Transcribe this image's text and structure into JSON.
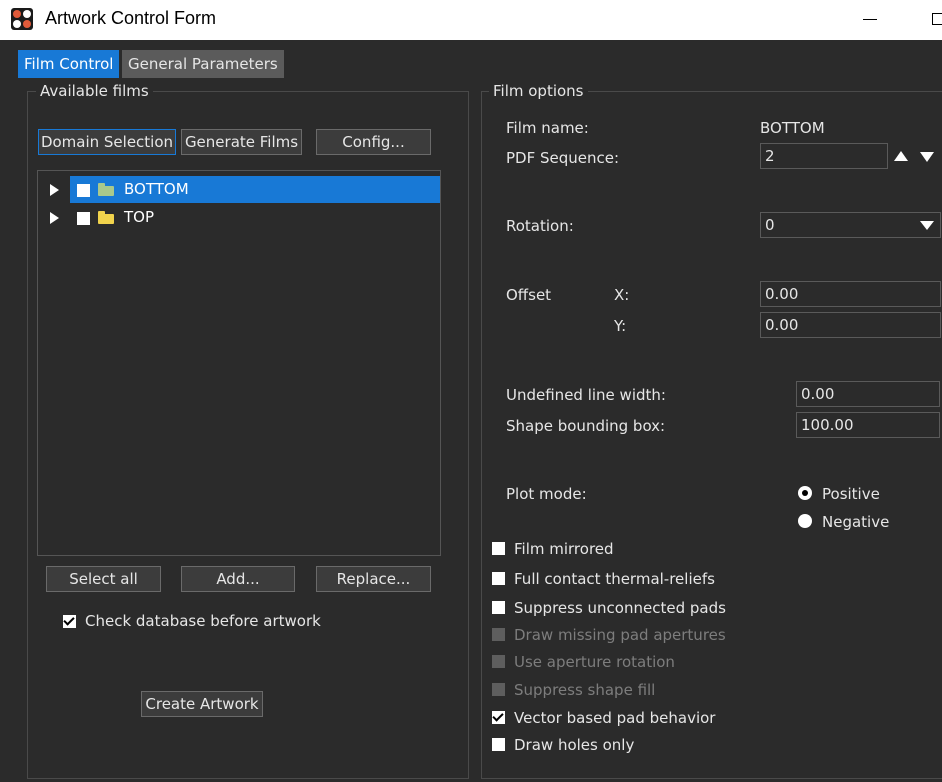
{
  "window": {
    "title": "Artwork Control Form"
  },
  "tabs": [
    {
      "label": "Film Control",
      "active": true
    },
    {
      "label": "General Parameters",
      "active": false
    }
  ],
  "available_films": {
    "group_label": "Available films",
    "buttons": {
      "domain_selection": "Domain Selection",
      "generate_films": "Generate Films",
      "config": "Config..."
    },
    "films": [
      {
        "name": "BOTTOM",
        "selected": true,
        "checked": false,
        "folder_icon": "folder-green-icon"
      },
      {
        "name": "TOP",
        "selected": false,
        "checked": false,
        "folder_icon": "folder-yellow-icon"
      }
    ],
    "actions": {
      "select_all": "Select all",
      "add": "Add...",
      "replace": "Replace..."
    },
    "check_database": {
      "label": "Check database before artwork",
      "checked": true
    },
    "create_artwork": "Create Artwork"
  },
  "film_options": {
    "group_label": "Film options",
    "film_name": {
      "label": "Film name:",
      "value": "BOTTOM"
    },
    "pdf_sequence": {
      "label": "PDF Sequence:",
      "value": "2"
    },
    "rotation": {
      "label": "Rotation:",
      "value": "0"
    },
    "offset": {
      "label": "Offset",
      "x_label": "X:",
      "x_value": "0.00",
      "y_label": "Y:",
      "y_value": "0.00"
    },
    "undefined_line_width": {
      "label": "Undefined line width:",
      "value": "0.00"
    },
    "shape_bounding_box": {
      "label": "Shape bounding box:",
      "value": "100.00"
    },
    "plot_mode": {
      "label": "Plot mode:",
      "positive": "Positive",
      "negative": "Negative",
      "selected": "Positive"
    },
    "options": {
      "film_mirrored": {
        "label": "Film mirrored",
        "checked": false,
        "enabled": true
      },
      "full_contact": {
        "label": "Full contact thermal-reliefs",
        "checked": false,
        "enabled": true
      },
      "suppress_unconnected": {
        "label": "Suppress unconnected pads",
        "checked": false,
        "enabled": true
      },
      "draw_missing": {
        "label": "Draw missing pad apertures",
        "checked": false,
        "enabled": false
      },
      "use_aperture_rotation": {
        "label": "Use aperture rotation",
        "checked": false,
        "enabled": false
      },
      "suppress_shape_fill": {
        "label": "Suppress shape fill",
        "checked": false,
        "enabled": false
      },
      "vector_based": {
        "label": "Vector based pad behavior",
        "checked": true,
        "enabled": true
      },
      "draw_holes_only": {
        "label": "Draw holes only",
        "checked": false,
        "enabled": true
      }
    }
  },
  "colors": {
    "background": "#2b2b2b",
    "accent": "#1879d6",
    "inactive_tab": "#5b5b5b",
    "disabled_text": "#7d7d7d"
  }
}
